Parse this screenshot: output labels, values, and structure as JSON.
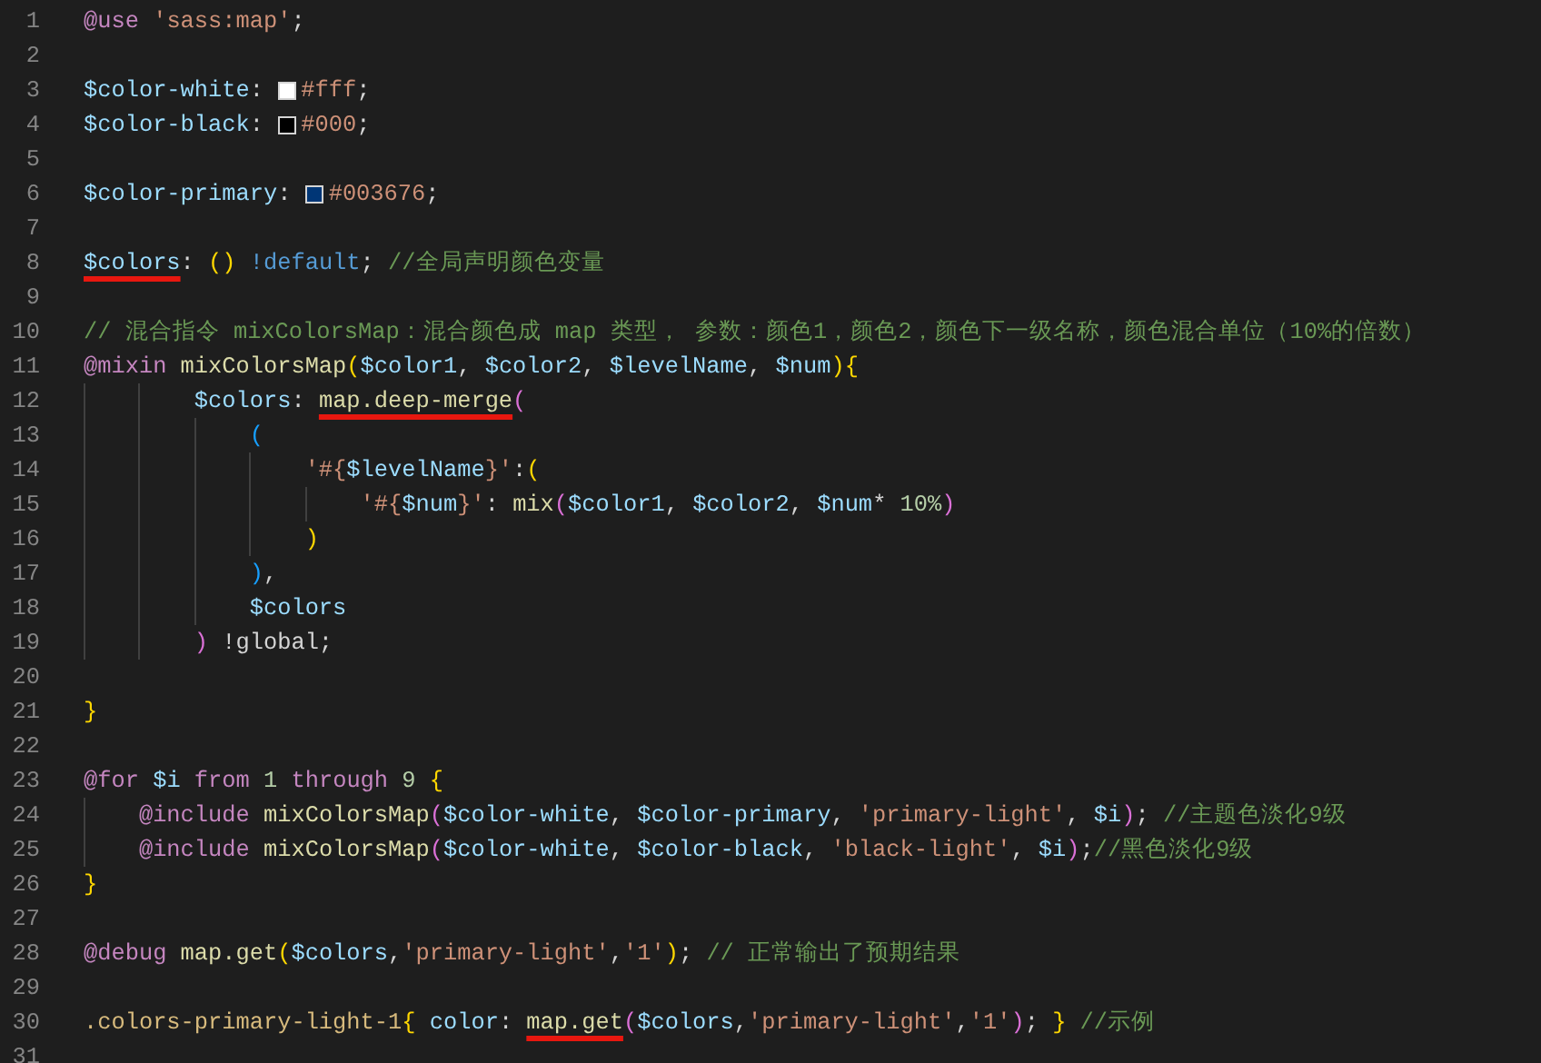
{
  "editor": {
    "lines": [
      {
        "number": "1",
        "tokens": [
          {
            "kind": "keyword",
            "text": "@use ",
            "underlined": false
          },
          {
            "kind": "string",
            "text": "'sass:map'",
            "underlined": false
          },
          {
            "kind": "punct",
            "text": ";",
            "underlined": false
          }
        ]
      },
      {
        "number": "2"
      },
      {
        "number": "3",
        "tokens": [
          {
            "kind": "variable",
            "text": "$color-white",
            "underlined": false
          },
          {
            "kind": "punct",
            "text": ": ",
            "underlined": false
          },
          {
            "kind": "swatch",
            "color": "#ffffff"
          },
          {
            "kind": "string",
            "text": "#fff",
            "underlined": false
          },
          {
            "kind": "punct",
            "text": ";",
            "underlined": false
          }
        ]
      },
      {
        "number": "4",
        "tokens": [
          {
            "kind": "variable",
            "text": "$color-black",
            "underlined": false
          },
          {
            "kind": "punct",
            "text": ": ",
            "underlined": false
          },
          {
            "kind": "swatch",
            "color": "#000000"
          },
          {
            "kind": "string",
            "text": "#000",
            "underlined": false
          },
          {
            "kind": "punct",
            "text": ";",
            "underlined": false
          }
        ]
      },
      {
        "number": "5"
      },
      {
        "number": "6",
        "tokens": [
          {
            "kind": "variable",
            "text": "$color-primary",
            "underlined": false
          },
          {
            "kind": "punct",
            "text": ": ",
            "underlined": false
          },
          {
            "kind": "swatch",
            "color": "#003676"
          },
          {
            "kind": "string",
            "text": "#003676",
            "underlined": false
          },
          {
            "kind": "punct",
            "text": ";",
            "underlined": false
          }
        ]
      },
      {
        "number": "7"
      },
      {
        "number": "8",
        "tokens": [
          {
            "kind": "variable",
            "text": "$colors",
            "underlined": true
          },
          {
            "kind": "punct",
            "text": ": ",
            "underlined": false
          },
          {
            "kind": "bracket1",
            "text": "() ",
            "underlined": false
          },
          {
            "kind": "flag",
            "text": "!default",
            "underlined": false
          },
          {
            "kind": "punct",
            "text": "; ",
            "underlined": false
          },
          {
            "kind": "comment",
            "text": "//全局声明颜色变量",
            "underlined": false
          }
        ]
      },
      {
        "number": "9"
      },
      {
        "number": "10",
        "tokens": [
          {
            "kind": "comment",
            "text": "// 混合指令 mixColorsMap：混合颜色成 map 类型， 参数：颜色1，颜色2，颜色下一级名称，颜色混合单位（10%的倍数）",
            "underlined": false
          }
        ]
      },
      {
        "number": "11",
        "tokens": [
          {
            "kind": "keyword",
            "text": "@mixin ",
            "underlined": false
          },
          {
            "kind": "function",
            "text": "mixColorsMap",
            "underlined": false
          },
          {
            "kind": "bracket1",
            "text": "(",
            "underlined": false
          },
          {
            "kind": "variable",
            "text": "$color1",
            "underlined": false
          },
          {
            "kind": "punct",
            "text": ", ",
            "underlined": false
          },
          {
            "kind": "variable",
            "text": "$color2",
            "underlined": false
          },
          {
            "kind": "punct",
            "text": ", ",
            "underlined": false
          },
          {
            "kind": "variable",
            "text": "$levelName",
            "underlined": false
          },
          {
            "kind": "punct",
            "text": ", ",
            "underlined": false
          },
          {
            "kind": "variable",
            "text": "$num",
            "underlined": false
          },
          {
            "kind": "bracket1",
            "text": "){",
            "underlined": false
          }
        ]
      },
      {
        "number": "12",
        "tokens": [
          {
            "kind": "variable",
            "text": "        $colors",
            "underlined": false
          },
          {
            "kind": "punct",
            "text": ": ",
            "underlined": false
          },
          {
            "kind": "function",
            "text": "map.deep-merge",
            "underlined": true
          },
          {
            "kind": "bracket2",
            "text": "(",
            "underlined": false
          }
        ]
      },
      {
        "number": "13",
        "tokens": [
          {
            "kind": "bracket3",
            "text": "            (",
            "underlined": false
          }
        ]
      },
      {
        "number": "14",
        "tokens": [
          {
            "kind": "string",
            "text": "                '#{",
            "underlined": false
          },
          {
            "kind": "variable",
            "text": "$levelName",
            "underlined": false
          },
          {
            "kind": "string",
            "text": "}'",
            "underlined": false
          },
          {
            "kind": "punct",
            "text": ":",
            "underlined": false
          },
          {
            "kind": "bracket1",
            "text": "(",
            "underlined": false
          }
        ]
      },
      {
        "number": "15",
        "tokens": [
          {
            "kind": "string",
            "text": "                    '#{",
            "underlined": false
          },
          {
            "kind": "variable",
            "text": "$num",
            "underlined": false
          },
          {
            "kind": "string",
            "text": "}'",
            "underlined": false
          },
          {
            "kind": "punct",
            "text": ": ",
            "underlined": false
          },
          {
            "kind": "function",
            "text": "mix",
            "underlined": false
          },
          {
            "kind": "bracket2",
            "text": "(",
            "underlined": false
          },
          {
            "kind": "variable",
            "text": "$color1",
            "underlined": false
          },
          {
            "kind": "punct",
            "text": ", ",
            "underlined": false
          },
          {
            "kind": "variable",
            "text": "$color2",
            "underlined": false
          },
          {
            "kind": "punct",
            "text": ", ",
            "underlined": false
          },
          {
            "kind": "variable",
            "text": "$num",
            "underlined": false
          },
          {
            "kind": "punct",
            "text": "* ",
            "underlined": false
          },
          {
            "kind": "number",
            "text": "10%",
            "underlined": false
          },
          {
            "kind": "bracket2",
            "text": ")",
            "underlined": false
          }
        ]
      },
      {
        "number": "16",
        "tokens": [
          {
            "kind": "bracket1",
            "text": "                )",
            "underlined": false
          }
        ]
      },
      {
        "number": "17",
        "tokens": [
          {
            "kind": "bracket3",
            "text": "            )",
            "underlined": false
          },
          {
            "kind": "punct",
            "text": ",",
            "underlined": false
          }
        ]
      },
      {
        "number": "18",
        "tokens": [
          {
            "kind": "variable",
            "text": "            $colors",
            "underlined": false
          }
        ]
      },
      {
        "number": "19",
        "tokens": [
          {
            "kind": "bracket2",
            "text": "        ) ",
            "underlined": false
          },
          {
            "kind": "punct",
            "text": "!global;",
            "underlined": false
          }
        ]
      },
      {
        "number": "20"
      },
      {
        "number": "21",
        "tokens": [
          {
            "kind": "bracket1",
            "text": "}",
            "underlined": false
          }
        ]
      },
      {
        "number": "22"
      },
      {
        "number": "23",
        "tokens": [
          {
            "kind": "keyword",
            "text": "@for ",
            "underlined": false
          },
          {
            "kind": "variable",
            "text": "$i ",
            "underlined": false
          },
          {
            "kind": "keyword",
            "text": "from ",
            "underlined": false
          },
          {
            "kind": "number",
            "text": "1 ",
            "underlined": false
          },
          {
            "kind": "keyword",
            "text": "through ",
            "underlined": false
          },
          {
            "kind": "number",
            "text": "9 ",
            "underlined": false
          },
          {
            "kind": "bracket1",
            "text": "{",
            "underlined": false
          }
        ]
      },
      {
        "number": "24",
        "tokens": [
          {
            "kind": "keyword",
            "text": "    @include ",
            "underlined": false
          },
          {
            "kind": "function",
            "text": "mixColorsMap",
            "underlined": false
          },
          {
            "kind": "bracket2",
            "text": "(",
            "underlined": false
          },
          {
            "kind": "variable",
            "text": "$color-white",
            "underlined": false
          },
          {
            "kind": "punct",
            "text": ", ",
            "underlined": false
          },
          {
            "kind": "variable",
            "text": "$color-primary",
            "underlined": false
          },
          {
            "kind": "punct",
            "text": ", ",
            "underlined": false
          },
          {
            "kind": "string",
            "text": "'primary-light'",
            "underlined": false
          },
          {
            "kind": "punct",
            "text": ", ",
            "underlined": false
          },
          {
            "kind": "variable",
            "text": "$i",
            "underlined": false
          },
          {
            "kind": "bracket2",
            "text": ")",
            "underlined": false
          },
          {
            "kind": "punct",
            "text": "; ",
            "underlined": false
          },
          {
            "kind": "comment",
            "text": "//主题色淡化9级",
            "underlined": false
          }
        ]
      },
      {
        "number": "25",
        "tokens": [
          {
            "kind": "keyword",
            "text": "    @include ",
            "underlined": false
          },
          {
            "kind": "function",
            "text": "mixColorsMap",
            "underlined": false
          },
          {
            "kind": "bracket2",
            "text": "(",
            "underlined": false
          },
          {
            "kind": "variable",
            "text": "$color-white",
            "underlined": false
          },
          {
            "kind": "punct",
            "text": ", ",
            "underlined": false
          },
          {
            "kind": "variable",
            "text": "$color-black",
            "underlined": false
          },
          {
            "kind": "punct",
            "text": ", ",
            "underlined": false
          },
          {
            "kind": "string",
            "text": "'black-light'",
            "underlined": false
          },
          {
            "kind": "punct",
            "text": ", ",
            "underlined": false
          },
          {
            "kind": "variable",
            "text": "$i",
            "underlined": false
          },
          {
            "kind": "bracket2",
            "text": ")",
            "underlined": false
          },
          {
            "kind": "punct",
            "text": ";",
            "underlined": false
          },
          {
            "kind": "comment",
            "text": "//黑色淡化9级",
            "underlined": false
          }
        ]
      },
      {
        "number": "26",
        "tokens": [
          {
            "kind": "bracket1",
            "text": "}",
            "underlined": false
          }
        ]
      },
      {
        "number": "27"
      },
      {
        "number": "28",
        "tokens": [
          {
            "kind": "keyword",
            "text": "@debug ",
            "underlined": false
          },
          {
            "kind": "function",
            "text": "map.get",
            "underlined": false
          },
          {
            "kind": "bracket1",
            "text": "(",
            "underlined": false
          },
          {
            "kind": "variable",
            "text": "$colors",
            "underlined": false
          },
          {
            "kind": "punct",
            "text": ",",
            "underlined": false
          },
          {
            "kind": "string",
            "text": "'primary-light'",
            "underlined": false
          },
          {
            "kind": "punct",
            "text": ",",
            "underlined": false
          },
          {
            "kind": "string",
            "text": "'1'",
            "underlined": false
          },
          {
            "kind": "bracket1",
            "text": ")",
            "underlined": false
          },
          {
            "kind": "punct",
            "text": "; ",
            "underlined": false
          },
          {
            "kind": "comment",
            "text": "// 正常输出了预期结果",
            "underlined": false
          }
        ]
      },
      {
        "number": "29"
      },
      {
        "number": "30",
        "tokens": [
          {
            "kind": "selector",
            "text": ".colors-primary-light-1",
            "underlined": false
          },
          {
            "kind": "bracket1",
            "text": "{ ",
            "underlined": false
          },
          {
            "kind": "property",
            "text": "color",
            "underlined": false
          },
          {
            "kind": "punct",
            "text": ": ",
            "underlined": false
          },
          {
            "kind": "function",
            "text": "map.get",
            "underlined": true
          },
          {
            "kind": "bracket2",
            "text": "(",
            "underlined": false
          },
          {
            "kind": "variable",
            "text": "$colors",
            "underlined": false
          },
          {
            "kind": "punct",
            "text": ",",
            "underlined": false
          },
          {
            "kind": "string",
            "text": "'primary-light'",
            "underlined": false
          },
          {
            "kind": "punct",
            "text": ",",
            "underlined": false
          },
          {
            "kind": "string",
            "text": "'1'",
            "underlined": false
          },
          {
            "kind": "bracket2",
            "text": ")",
            "underlined": false
          },
          {
            "kind": "punct",
            "text": "; ",
            "underlined": false
          },
          {
            "kind": "bracket1",
            "text": "} ",
            "underlined": false
          },
          {
            "kind": "comment",
            "text": "//示例",
            "underlined": false
          }
        ]
      },
      {
        "number": "31"
      }
    ]
  }
}
